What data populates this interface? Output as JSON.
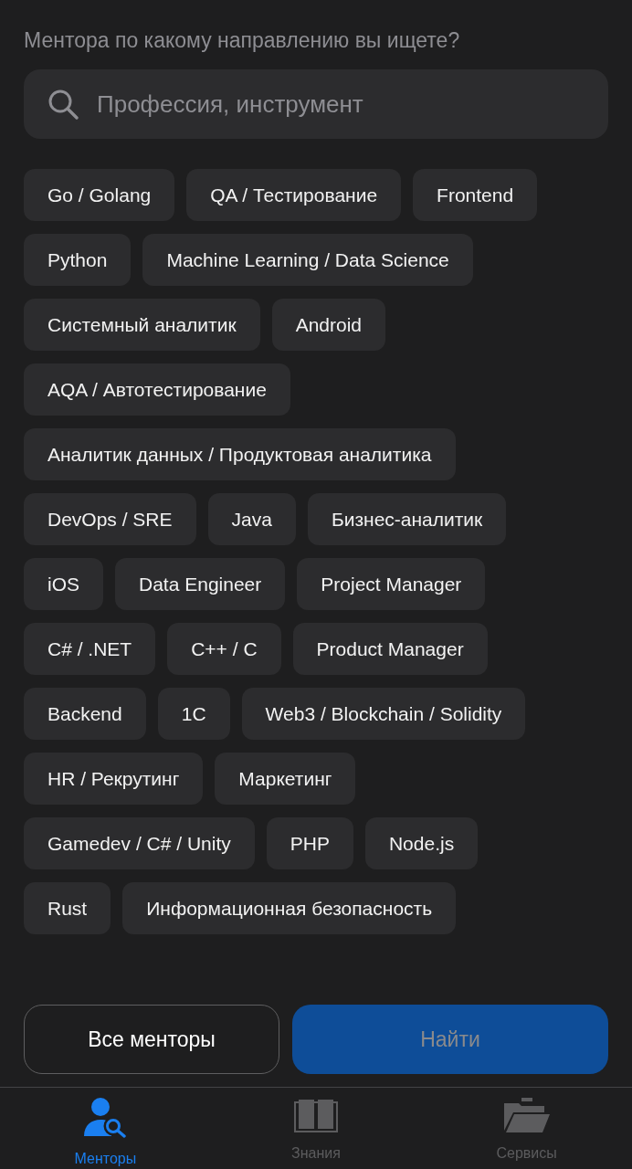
{
  "prompt": "Ментора по какому направлению вы ищете?",
  "search": {
    "placeholder": "Профессия, инструмент"
  },
  "direction_rows": [
    [
      {
        "label": "Go / Golang",
        "selected": false
      },
      {
        "label": "QA / Тестирование",
        "selected": false
      },
      {
        "label": "Frontend",
        "selected": false
      }
    ],
    [
      {
        "label": "Python",
        "selected": false
      },
      {
        "label": "Machine Learning / Data Science",
        "selected": false
      }
    ],
    [
      {
        "label": "Системный аналитик",
        "selected": false
      },
      {
        "label": "Android",
        "selected": false
      }
    ],
    [
      {
        "label": "AQA / Автотестирование",
        "selected": false
      }
    ],
    [
      {
        "label": "Аналитик данных / Продуктовая аналитика",
        "selected": false
      }
    ],
    [
      {
        "label": "DevOps / SRE",
        "selected": false
      },
      {
        "label": "Java",
        "selected": false
      },
      {
        "label": "Бизнес-аналитик",
        "selected": false
      }
    ],
    [
      {
        "label": "iOS",
        "selected": false
      },
      {
        "label": "Data Engineer",
        "selected": false
      },
      {
        "label": "Project Manager",
        "selected": false
      }
    ],
    [
      {
        "label": "C# / .NET",
        "selected": false
      },
      {
        "label": "C++ / C",
        "selected": false
      },
      {
        "label": "Product Manager",
        "selected": false
      }
    ],
    [
      {
        "label": "Backend",
        "selected": false
      },
      {
        "label": "1C",
        "selected": false
      },
      {
        "label": "Web3 / Blockchain / Solidity",
        "selected": false
      }
    ],
    [
      {
        "label": "HR / Рекрутинг",
        "selected": false
      },
      {
        "label": "Маркетинг",
        "selected": false
      }
    ],
    [
      {
        "label": "Gamedev / C# / Unity",
        "selected": false
      },
      {
        "label": "PHP",
        "selected": false
      },
      {
        "label": "Node.js",
        "selected": false
      }
    ],
    [
      {
        "label": "Rust",
        "selected": false
      },
      {
        "label": "Информационная безопасность",
        "selected": false
      }
    ]
  ],
  "actions": [
    {
      "label": "Все менторы",
      "kind": "outline",
      "disabled": false
    },
    {
      "label": "Найти",
      "kind": "primary",
      "disabled": true
    }
  ],
  "tab_bar": [
    {
      "label": "Менторы",
      "selected": true
    },
    {
      "label": "Знания",
      "selected": false
    },
    {
      "label": "Сервисы",
      "selected": false
    }
  ]
}
